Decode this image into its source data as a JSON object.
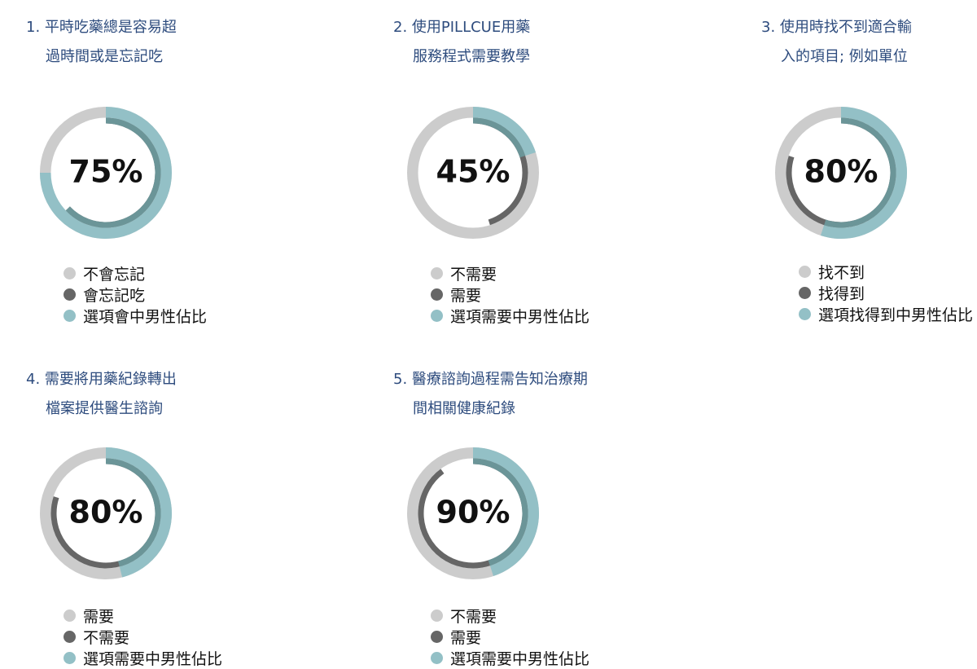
{
  "colors": {
    "outer_base": "#cccccc",
    "outer_highlight": "#93c0c6",
    "inner_base": "#ffffff",
    "inner_highlight": "#666666",
    "overlap": "#6b9598",
    "title_text": "#2e4c7e"
  },
  "chart_data": [
    {
      "type": "pie",
      "title_lines": [
        "1. 平時吃藥總是容易超",
        "過時間或是忘記吃"
      ],
      "center_label": "75%",
      "outer_ring_percent": 75,
      "inner_ring_percent": 63,
      "legend": [
        "不會忘記",
        "會忘記吃",
        "選項會中男性佔比"
      ]
    },
    {
      "type": "pie",
      "title_lines": [
        "2. 使用PILLCUE用藥",
        "服務程式需要教學"
      ],
      "center_label": "45%",
      "outer_ring_percent": 20,
      "inner_ring_percent": 45,
      "legend": [
        "不需要",
        "需要",
        "選項需要中男性佔比"
      ]
    },
    {
      "type": "pie",
      "title_lines": [
        "3. 使用時找不到適合輸",
        "入的項目; 例如單位"
      ],
      "center_label": "80%",
      "outer_ring_percent": 55,
      "inner_ring_percent": 80,
      "legend": [
        "找不到",
        "找得到",
        "選項找得到中男性佔比"
      ]
    },
    {
      "type": "pie",
      "title_lines": [
        "4. 需要將用藥紀錄轉出",
        "檔案提供醫生諮詢"
      ],
      "center_label": "80%",
      "outer_ring_percent": 46,
      "inner_ring_percent": 80,
      "legend": [
        "需要",
        "不需要",
        "選項需要中男性佔比"
      ]
    },
    {
      "type": "pie",
      "title_lines": [
        "5. 醫療諮詢過程需告知治療期",
        "間相關健康紀錄"
      ],
      "center_label": "90%",
      "outer_ring_percent": 45,
      "inner_ring_percent": 90,
      "legend": [
        "不需要",
        "需要",
        "選項需要中男性佔比"
      ]
    }
  ]
}
